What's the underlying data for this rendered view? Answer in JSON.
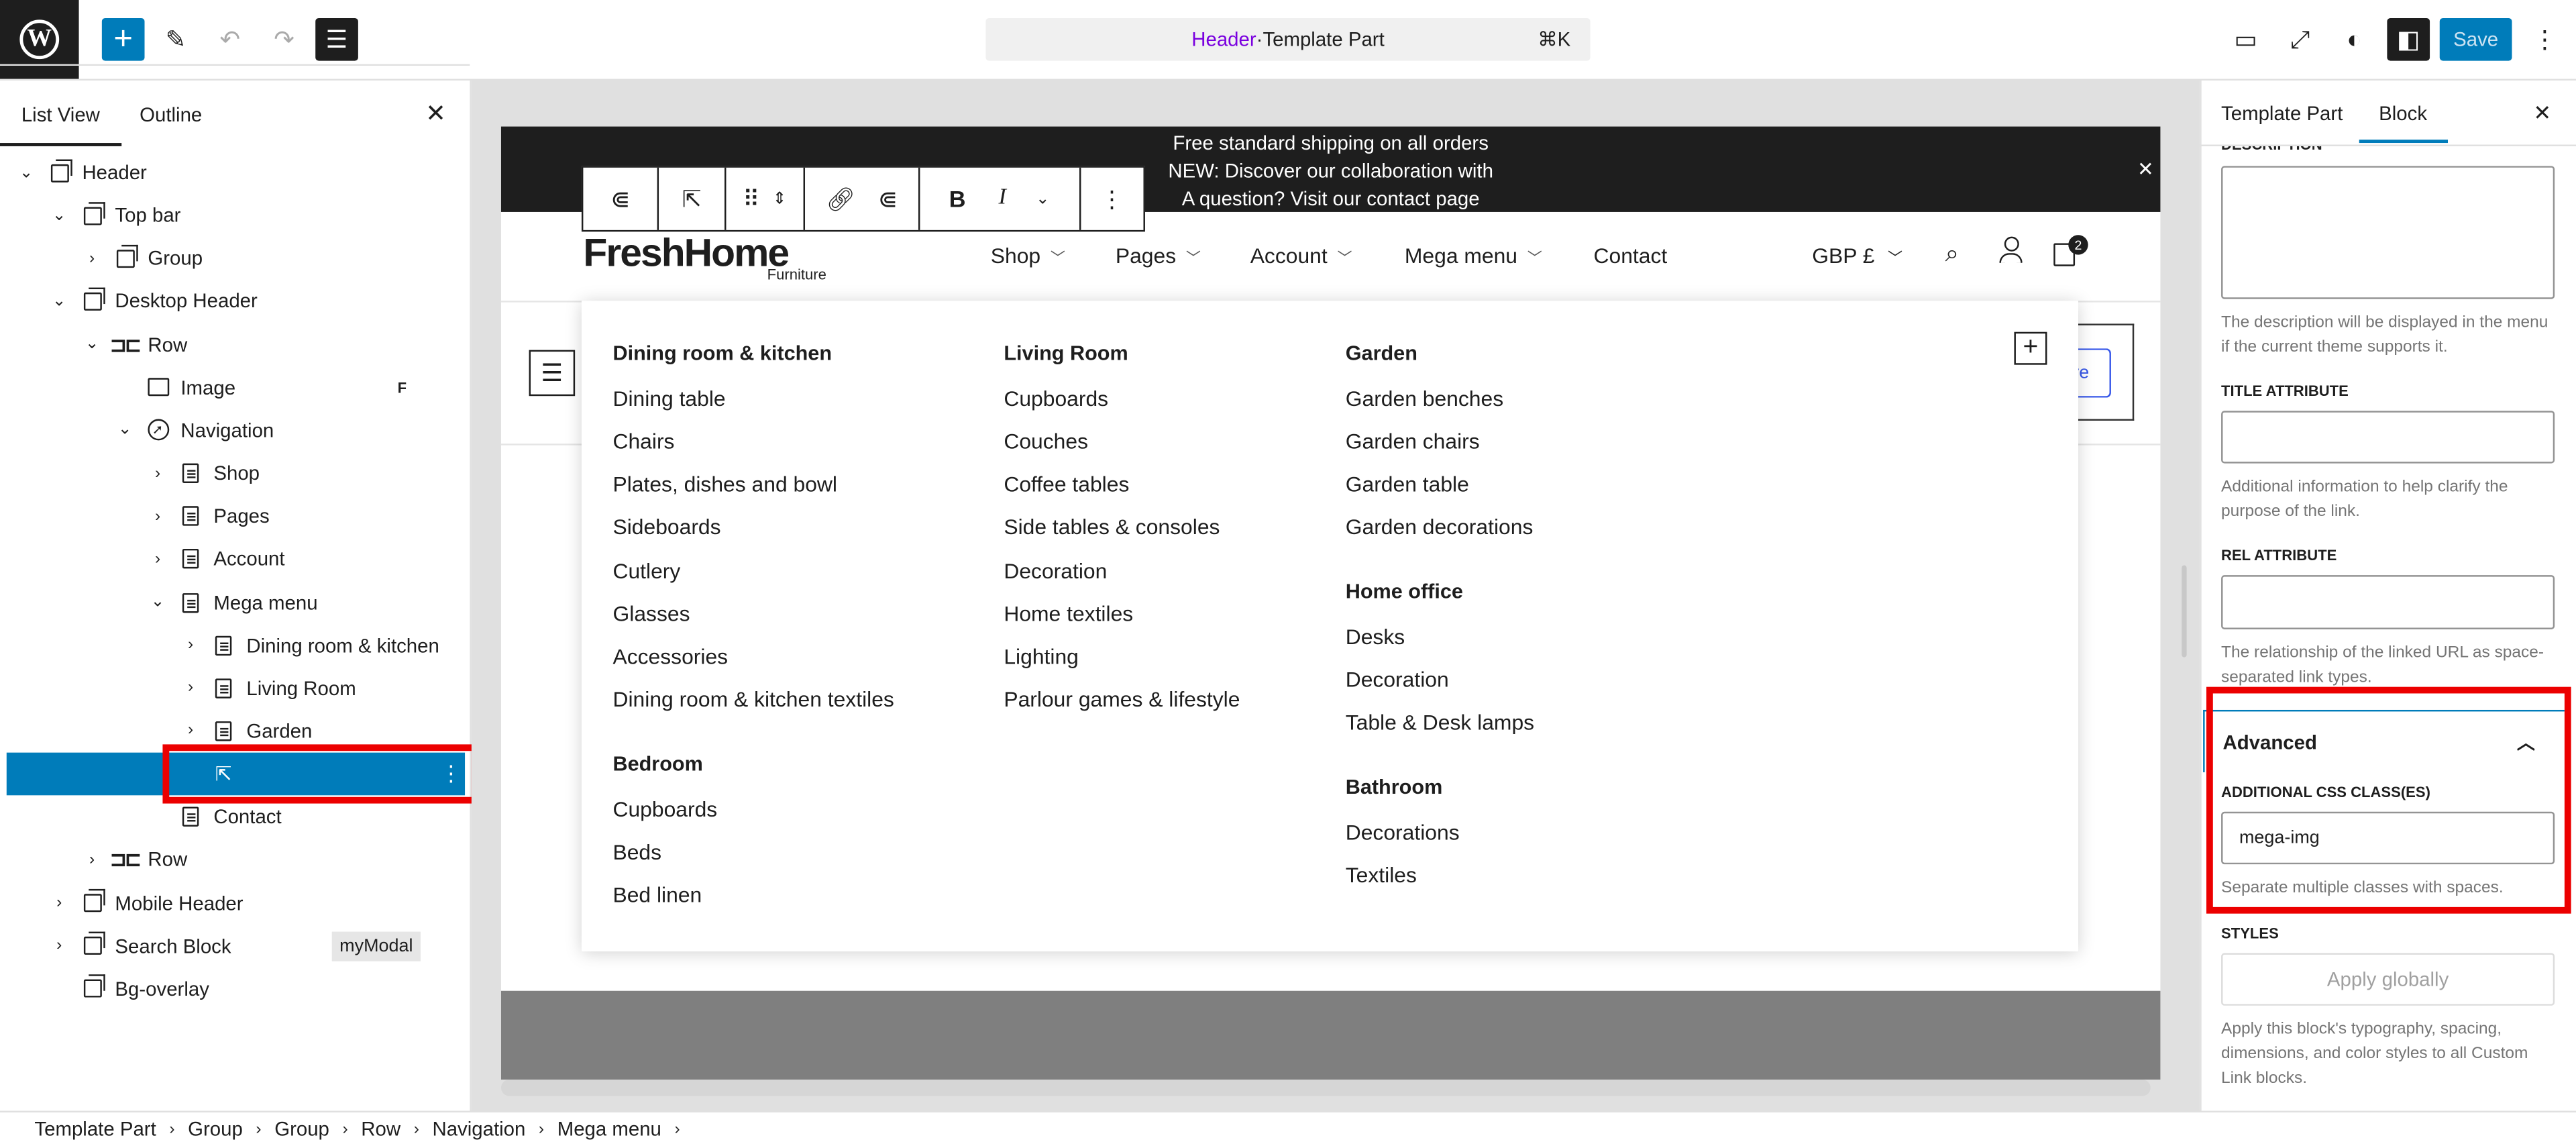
{
  "header_bar": {
    "logo_glyph": "W",
    "title_part": "Header",
    "title_sep": " · ",
    "title_rest": "Template Part",
    "shortcut": "⌘K",
    "save_label": "Save",
    "accent_color": "#007cba"
  },
  "left_panel": {
    "tabs": [
      "List View",
      "Outline"
    ],
    "tree": [
      {
        "label": "Header",
        "icon": "template-part-icon",
        "depth": 0,
        "chevron": "expanded"
      },
      {
        "label": "Top bar",
        "icon": "template-part-icon",
        "depth": 1,
        "chevron": "expanded"
      },
      {
        "label": "Group",
        "icon": "template-part-icon",
        "depth": 2,
        "chevron": "collapsed"
      },
      {
        "label": "Desktop Header",
        "icon": "template-part-icon",
        "depth": 1,
        "chevron": "expanded"
      },
      {
        "label": "Row",
        "icon": "row-icon",
        "depth": 2,
        "chevron": "expanded"
      },
      {
        "label": "Image",
        "icon": "image-icon",
        "depth": 3,
        "chevron": "none",
        "thumb": "F"
      },
      {
        "label": "Navigation",
        "icon": "navigation-icon",
        "depth": 3,
        "chevron": "expanded"
      },
      {
        "label": "Shop",
        "icon": "page-icon",
        "depth": 4,
        "chevron": "collapsed"
      },
      {
        "label": "Pages",
        "icon": "page-icon",
        "depth": 4,
        "chevron": "collapsed"
      },
      {
        "label": "Account",
        "icon": "page-icon",
        "depth": 4,
        "chevron": "collapsed"
      },
      {
        "label": "Mega menu",
        "icon": "page-icon",
        "depth": 4,
        "chevron": "expanded"
      },
      {
        "label": "Dining room & kitchen",
        "icon": "page-icon",
        "depth": 5,
        "chevron": "collapsed"
      },
      {
        "label": "Living Room",
        "icon": "page-icon",
        "depth": 5,
        "chevron": "collapsed"
      },
      {
        "label": "Garden",
        "icon": "page-icon",
        "depth": 5,
        "chevron": "collapsed"
      },
      {
        "label": "",
        "icon": "custom-link-icon",
        "depth": 5,
        "chevron": "none",
        "selected": true
      },
      {
        "label": "Contact",
        "icon": "page-icon",
        "depth": 4,
        "chevron": "none"
      },
      {
        "label": "Row",
        "icon": "row-icon",
        "depth": 2,
        "chevron": "collapsed"
      },
      {
        "label": "Mobile Header",
        "icon": "template-part-icon",
        "depth": 1,
        "chevron": "collapsed"
      },
      {
        "label": "Search Block",
        "icon": "template-part-icon",
        "depth": 1,
        "chevron": "collapsed",
        "tag": "myModal"
      },
      {
        "label": "Bg-overlay",
        "icon": "template-part-icon",
        "depth": 1,
        "chevron": "none"
      }
    ],
    "selected_highlight": "#007cba"
  },
  "canvas": {
    "announcement": [
      "Free standard shipping on all orders",
      "NEW: Discover our collaboration with",
      "A question? Visit our contact page"
    ],
    "logo_text": "FreshHome",
    "logo_sub": "Furniture",
    "nav": [
      {
        "label": "Shop",
        "caret": true
      },
      {
        "label": "Pages",
        "caret": true
      },
      {
        "label": "Account",
        "caret": true
      },
      {
        "label": "Mega menu",
        "caret": true
      },
      {
        "label": "Contact",
        "caret": false
      }
    ],
    "currency": "GBP £",
    "cart_count": "2",
    "right_btn_text": "ve",
    "mega_menu": {
      "columns": [
        {
          "sections": [
            {
              "heading": "Dining room & kitchen",
              "items": [
                "Dining table",
                "Chairs",
                "Plates, dishes and bowl",
                "Sideboards",
                "Cutlery",
                "Glasses",
                "Accessories",
                "Dining room & kitchen textiles"
              ]
            },
            {
              "heading": "Bedroom",
              "items": [
                "Cupboards",
                "Beds",
                "Bed linen"
              ]
            }
          ]
        },
        {
          "sections": [
            {
              "heading": "Living Room",
              "items": [
                "Cupboards",
                "Couches",
                "Coffee tables",
                "Side tables & consoles",
                "Decoration",
                "Home textiles",
                "Lighting",
                "Parlour games & lifestyle"
              ]
            }
          ]
        },
        {
          "sections": [
            {
              "heading": "Garden",
              "items": [
                "Garden benches",
                "Garden chairs",
                "Garden table",
                "Garden decorations"
              ]
            },
            {
              "heading": "Home office",
              "items": [
                "Desks",
                "Decoration",
                "Table & Desk lamps"
              ]
            },
            {
              "heading": "Bathroom",
              "items": [
                "Decorations",
                "Textiles"
              ]
            }
          ]
        }
      ]
    }
  },
  "right_panel": {
    "tabs": [
      "Template Part",
      "Block"
    ],
    "description_label": "DESCRIPTION",
    "description_help": "The description will be displayed in the menu if the current theme supports it.",
    "title_attr_label": "TITLE ATTRIBUTE",
    "title_attr_help": "Additional information to help clarify the purpose of the link.",
    "rel_attr_label": "REL ATTRIBUTE",
    "rel_attr_help": "The relationship of the linked URL as space-separated link types.",
    "advanced_label": "Advanced",
    "css_label": "ADDITIONAL CSS CLASS(ES)",
    "css_value": "mega-img",
    "css_help": "Separate multiple classes with spaces.",
    "styles_label": "STYLES",
    "apply_globally": "Apply globally",
    "styles_help": "Apply this block's typography, spacing, dimensions, and color styles to all Custom Link blocks."
  },
  "breadcrumbs": [
    "Template Part",
    "Group",
    "Group",
    "Row",
    "Navigation",
    "Mega menu"
  ]
}
